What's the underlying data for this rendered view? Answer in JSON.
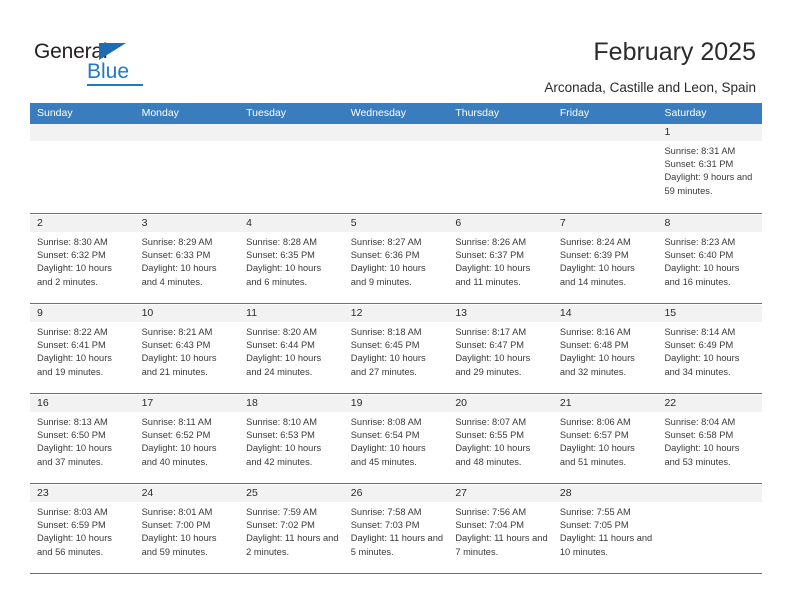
{
  "brand": {
    "name_part1": "General",
    "name_part2": "Blue"
  },
  "header": {
    "title": "February 2025",
    "location": "Arconada, Castille and Leon, Spain"
  },
  "calendar": {
    "weekday_headers": [
      "Sunday",
      "Monday",
      "Tuesday",
      "Wednesday",
      "Thursday",
      "Friday",
      "Saturday"
    ],
    "weeks": [
      [
        {
          "day": "",
          "sunrise": "",
          "sunset": "",
          "daylight": ""
        },
        {
          "day": "",
          "sunrise": "",
          "sunset": "",
          "daylight": ""
        },
        {
          "day": "",
          "sunrise": "",
          "sunset": "",
          "daylight": ""
        },
        {
          "day": "",
          "sunrise": "",
          "sunset": "",
          "daylight": ""
        },
        {
          "day": "",
          "sunrise": "",
          "sunset": "",
          "daylight": ""
        },
        {
          "day": "",
          "sunrise": "",
          "sunset": "",
          "daylight": ""
        },
        {
          "day": "1",
          "sunrise": "Sunrise: 8:31 AM",
          "sunset": "Sunset: 6:31 PM",
          "daylight": "Daylight: 9 hours and 59 minutes."
        }
      ],
      [
        {
          "day": "2",
          "sunrise": "Sunrise: 8:30 AM",
          "sunset": "Sunset: 6:32 PM",
          "daylight": "Daylight: 10 hours and 2 minutes."
        },
        {
          "day": "3",
          "sunrise": "Sunrise: 8:29 AM",
          "sunset": "Sunset: 6:33 PM",
          "daylight": "Daylight: 10 hours and 4 minutes."
        },
        {
          "day": "4",
          "sunrise": "Sunrise: 8:28 AM",
          "sunset": "Sunset: 6:35 PM",
          "daylight": "Daylight: 10 hours and 6 minutes."
        },
        {
          "day": "5",
          "sunrise": "Sunrise: 8:27 AM",
          "sunset": "Sunset: 6:36 PM",
          "daylight": "Daylight: 10 hours and 9 minutes."
        },
        {
          "day": "6",
          "sunrise": "Sunrise: 8:26 AM",
          "sunset": "Sunset: 6:37 PM",
          "daylight": "Daylight: 10 hours and 11 minutes."
        },
        {
          "day": "7",
          "sunrise": "Sunrise: 8:24 AM",
          "sunset": "Sunset: 6:39 PM",
          "daylight": "Daylight: 10 hours and 14 minutes."
        },
        {
          "day": "8",
          "sunrise": "Sunrise: 8:23 AM",
          "sunset": "Sunset: 6:40 PM",
          "daylight": "Daylight: 10 hours and 16 minutes."
        }
      ],
      [
        {
          "day": "9",
          "sunrise": "Sunrise: 8:22 AM",
          "sunset": "Sunset: 6:41 PM",
          "daylight": "Daylight: 10 hours and 19 minutes."
        },
        {
          "day": "10",
          "sunrise": "Sunrise: 8:21 AM",
          "sunset": "Sunset: 6:43 PM",
          "daylight": "Daylight: 10 hours and 21 minutes."
        },
        {
          "day": "11",
          "sunrise": "Sunrise: 8:20 AM",
          "sunset": "Sunset: 6:44 PM",
          "daylight": "Daylight: 10 hours and 24 minutes."
        },
        {
          "day": "12",
          "sunrise": "Sunrise: 8:18 AM",
          "sunset": "Sunset: 6:45 PM",
          "daylight": "Daylight: 10 hours and 27 minutes."
        },
        {
          "day": "13",
          "sunrise": "Sunrise: 8:17 AM",
          "sunset": "Sunset: 6:47 PM",
          "daylight": "Daylight: 10 hours and 29 minutes."
        },
        {
          "day": "14",
          "sunrise": "Sunrise: 8:16 AM",
          "sunset": "Sunset: 6:48 PM",
          "daylight": "Daylight: 10 hours and 32 minutes."
        },
        {
          "day": "15",
          "sunrise": "Sunrise: 8:14 AM",
          "sunset": "Sunset: 6:49 PM",
          "daylight": "Daylight: 10 hours and 34 minutes."
        }
      ],
      [
        {
          "day": "16",
          "sunrise": "Sunrise: 8:13 AM",
          "sunset": "Sunset: 6:50 PM",
          "daylight": "Daylight: 10 hours and 37 minutes."
        },
        {
          "day": "17",
          "sunrise": "Sunrise: 8:11 AM",
          "sunset": "Sunset: 6:52 PM",
          "daylight": "Daylight: 10 hours and 40 minutes."
        },
        {
          "day": "18",
          "sunrise": "Sunrise: 8:10 AM",
          "sunset": "Sunset: 6:53 PM",
          "daylight": "Daylight: 10 hours and 42 minutes."
        },
        {
          "day": "19",
          "sunrise": "Sunrise: 8:08 AM",
          "sunset": "Sunset: 6:54 PM",
          "daylight": "Daylight: 10 hours and 45 minutes."
        },
        {
          "day": "20",
          "sunrise": "Sunrise: 8:07 AM",
          "sunset": "Sunset: 6:55 PM",
          "daylight": "Daylight: 10 hours and 48 minutes."
        },
        {
          "day": "21",
          "sunrise": "Sunrise: 8:06 AM",
          "sunset": "Sunset: 6:57 PM",
          "daylight": "Daylight: 10 hours and 51 minutes."
        },
        {
          "day": "22",
          "sunrise": "Sunrise: 8:04 AM",
          "sunset": "Sunset: 6:58 PM",
          "daylight": "Daylight: 10 hours and 53 minutes."
        }
      ],
      [
        {
          "day": "23",
          "sunrise": "Sunrise: 8:03 AM",
          "sunset": "Sunset: 6:59 PM",
          "daylight": "Daylight: 10 hours and 56 minutes."
        },
        {
          "day": "24",
          "sunrise": "Sunrise: 8:01 AM",
          "sunset": "Sunset: 7:00 PM",
          "daylight": "Daylight: 10 hours and 59 minutes."
        },
        {
          "day": "25",
          "sunrise": "Sunrise: 7:59 AM",
          "sunset": "Sunset: 7:02 PM",
          "daylight": "Daylight: 11 hours and 2 minutes."
        },
        {
          "day": "26",
          "sunrise": "Sunrise: 7:58 AM",
          "sunset": "Sunset: 7:03 PM",
          "daylight": "Daylight: 11 hours and 5 minutes."
        },
        {
          "day": "27",
          "sunrise": "Sunrise: 7:56 AM",
          "sunset": "Sunset: 7:04 PM",
          "daylight": "Daylight: 11 hours and 7 minutes."
        },
        {
          "day": "28",
          "sunrise": "Sunrise: 7:55 AM",
          "sunset": "Sunset: 7:05 PM",
          "daylight": "Daylight: 11 hours and 10 minutes."
        },
        {
          "day": "",
          "sunrise": "",
          "sunset": "",
          "daylight": ""
        }
      ]
    ]
  },
  "colors": {
    "header_blue": "#3a7dbf",
    "brand_blue": "#2079c8",
    "band_gray": "#f2f2f2"
  }
}
